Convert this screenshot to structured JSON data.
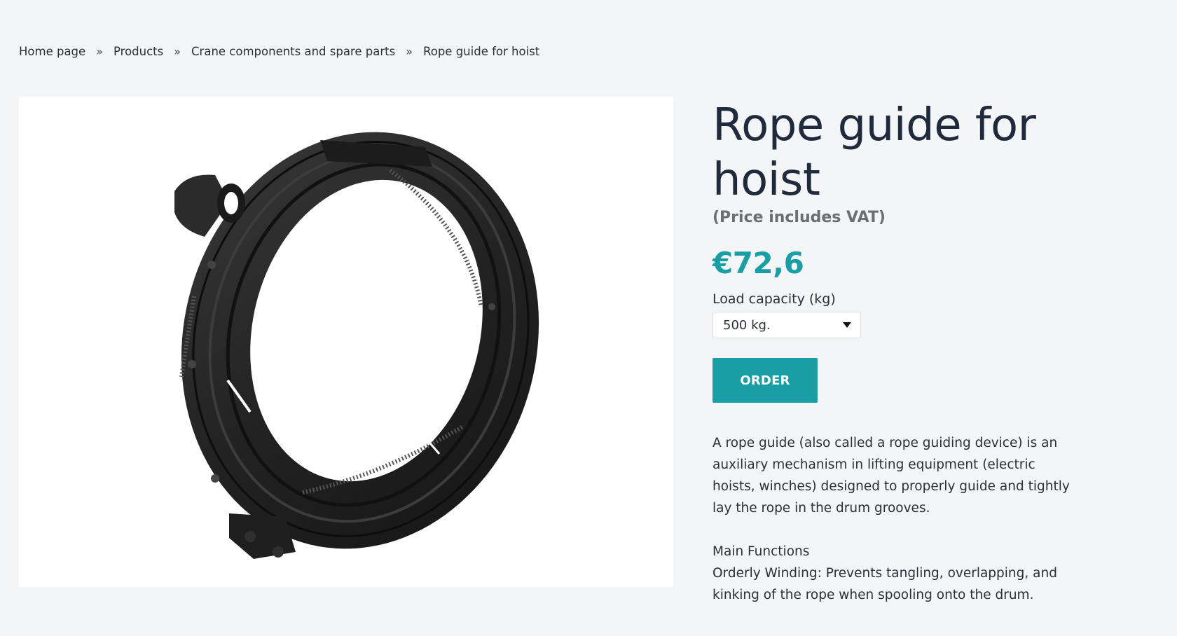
{
  "breadcrumb": {
    "items": [
      "Home page",
      "Products",
      "Crane components and spare parts",
      "Rope guide for hoist"
    ],
    "separator": "»"
  },
  "product": {
    "image_alt": "Rope guide for hoist",
    "title": "Rope guide for hoist",
    "vat_note": "(Price includes VAT)",
    "price": "€72,6",
    "load_capacity_label": "Load capacity (kg)",
    "load_capacity_selected": "500 kg.",
    "order_label": "ORDER",
    "description_p1": "A rope guide (also called a rope guiding device) is an auxiliary mechanism in lifting equipment (electric hoists, winches) designed to properly guide and tightly lay the rope in the drum grooves.",
    "functions_heading": "Main Functions",
    "functions_text": "Orderly Winding: Prevents tangling, overlapping, and kinking of the rope when spooling onto the drum."
  },
  "colors": {
    "accent": "#1a9ea6",
    "background": "#f4f5f7",
    "title": "#1f2a3c"
  },
  "icons": {
    "dropdown": "chevron-down-icon"
  }
}
